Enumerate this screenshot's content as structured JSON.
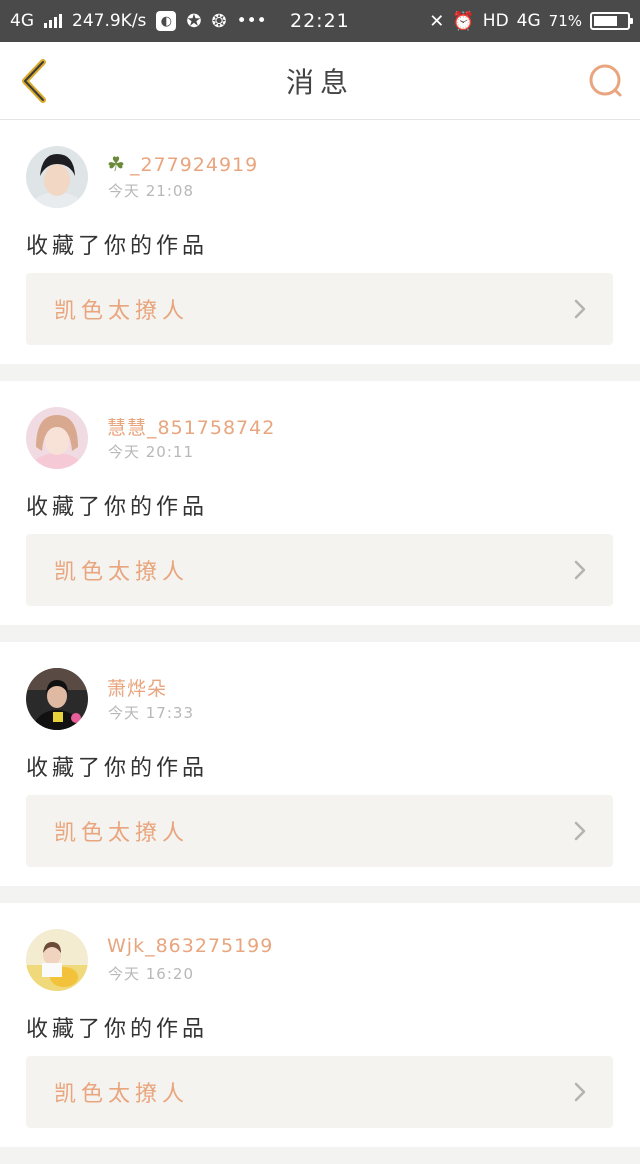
{
  "status_bar": {
    "network": "4G",
    "speed": "247.9K/s",
    "dots": "•••",
    "time": "22:21",
    "hd": "HD",
    "network2": "4G",
    "battery": "71%",
    "battery_level": 0.71
  },
  "nav": {
    "title": "消息",
    "back_icon": "chevron-left-icon",
    "search_icon": "search-icon",
    "accent_color": "#e8a57e",
    "back_color": "#d9a92a"
  },
  "messages": [
    {
      "username": "_277924919",
      "has_clover": true,
      "time": "今天 21:08",
      "action": "收藏了你的作品",
      "work_title": "凯色太撩人"
    },
    {
      "username": "慧慧_851758742",
      "has_clover": false,
      "time": "今天 20:11",
      "action": "收藏了你的作品",
      "work_title": "凯色太撩人"
    },
    {
      "username": "萧烨朵",
      "has_clover": false,
      "time": "今天 17:33",
      "action": "收藏了你的作品",
      "work_title": "凯色太撩人"
    },
    {
      "username": "Wjk_863275199",
      "has_clover": false,
      "time": "今天 16:20",
      "action": "收藏了你的作品",
      "work_title": "凯色太撩人"
    }
  ]
}
